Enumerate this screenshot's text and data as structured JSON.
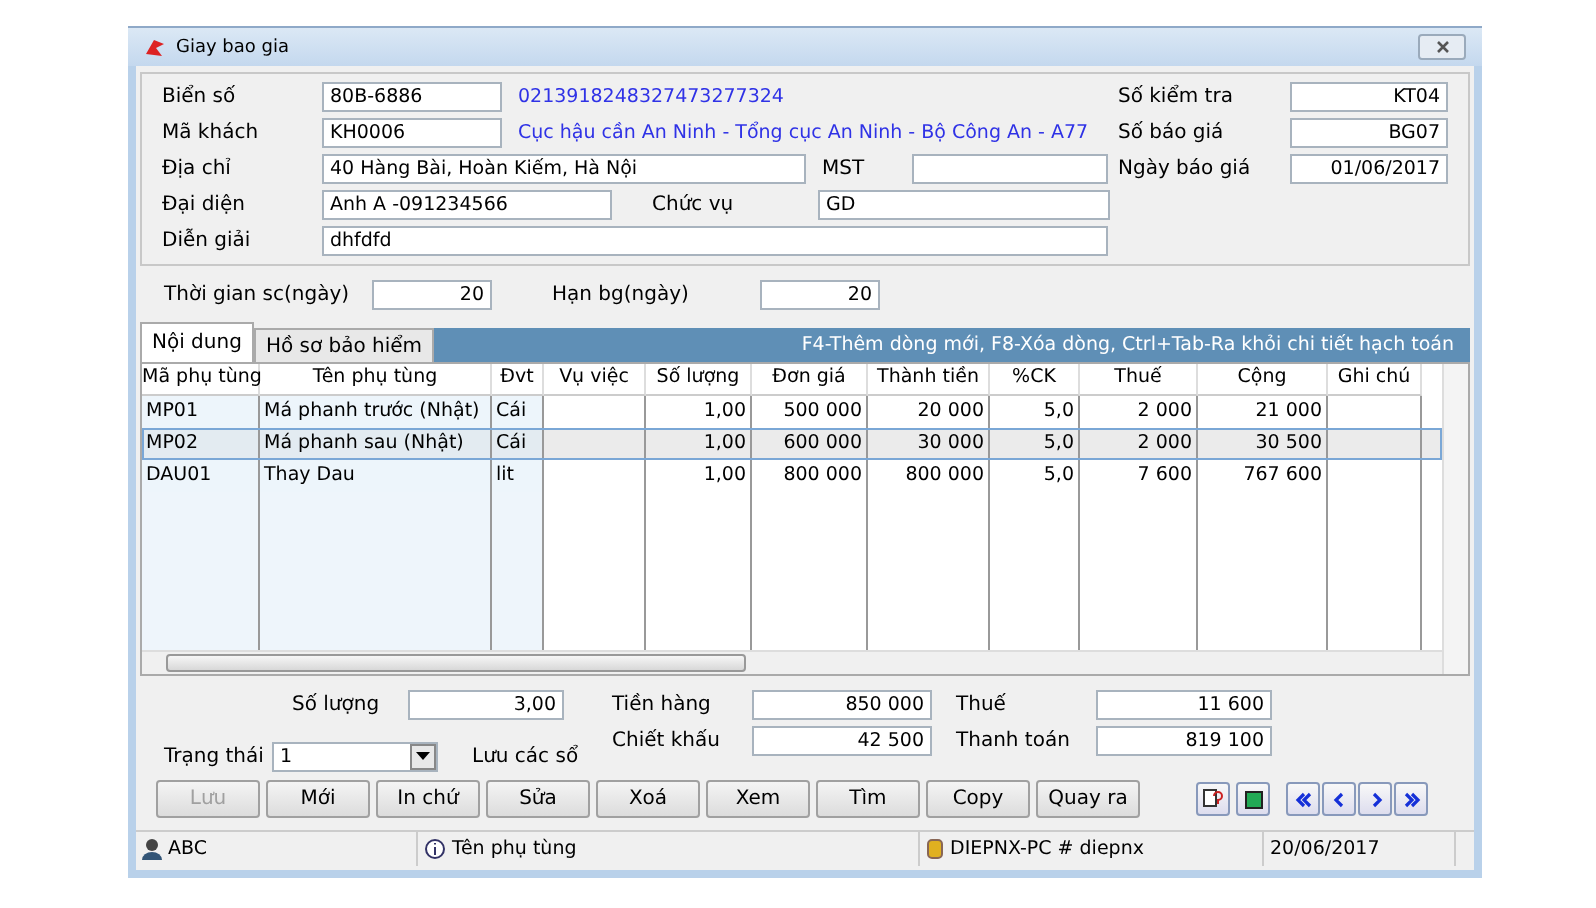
{
  "window": {
    "title": "Giay bao gia"
  },
  "header": {
    "fields": [
      {
        "label": "Biển số",
        "value": "80B-6886",
        "note": "0213918248327473277324"
      },
      {
        "label": "Mã khách",
        "value": "KH0006",
        "note": "Cục hậu cần An Ninh - Tổng cục An Ninh - Bộ Công An - A77"
      }
    ],
    "address": {
      "label": "Địa chỉ",
      "value": "40 Hàng Bài, Hoàn Kiếm, Hà Nội",
      "label2": "MST"
    },
    "rep": {
      "label": "Đại diện",
      "value": "Anh A -091234566",
      "label2": "Chức vụ",
      "value2": "GD"
    },
    "desc": {
      "label": "Diễn giải",
      "value": "dhfdfd"
    },
    "right": [
      {
        "label": "Số kiểm tra",
        "value": "KT04"
      },
      {
        "label": "Số báo giá",
        "value": "BG07"
      },
      {
        "label": "Ngày báo giá",
        "value": "01/06/2017"
      }
    ]
  },
  "times": [
    {
      "label": "Thời gian sc(ngày)",
      "value": "20"
    },
    {
      "label": "Hạn bg(ngày)",
      "value": "20"
    }
  ],
  "tabs": [
    {
      "label": "Nội dung",
      "selected": true
    },
    {
      "label": "Hồ sơ bảo hiểm",
      "selected": false
    }
  ],
  "hint": "F4-Thêm dòng mới, F8-Xóa dòng, Ctrl+Tab-Ra khỏi chi tiết hạch toán",
  "table": {
    "columns": [
      "Mã phụ tùng",
      "Tên phụ tùng",
      "Đvt",
      "Vụ việc",
      "Số lượng",
      "Đơn giá",
      "Thành tiền",
      "%CK",
      "Thuế",
      "Cộng",
      "Ghi chú"
    ],
    "rows": [
      {
        "selected": false,
        "cells": [
          "MP01",
          "Má phanh trước (Nhật)",
          "Cái",
          "",
          "1,00",
          "500 000",
          "20 000",
          "5,0",
          "2 000",
          "21 000",
          ""
        ]
      },
      {
        "selected": true,
        "cells": [
          "MP02",
          "Má phanh sau (Nhật)",
          "Cái",
          "",
          "1,00",
          "600 000",
          "30 000",
          "5,0",
          "2 000",
          "30 500",
          ""
        ]
      },
      {
        "selected": false,
        "cells": [
          "DAU01",
          "Thay Dau",
          "lit",
          "",
          "1,00",
          "800 000",
          "800 000",
          "5,0",
          "7 600",
          "767 600",
          ""
        ]
      }
    ]
  },
  "totals": [
    {
      "label": "Số lượng",
      "value": "3,00"
    },
    {
      "label": "Tiền hàng",
      "value": "850 000"
    },
    {
      "label": "Thuế",
      "value": "11 600"
    },
    {
      "label": "Chiết khấu",
      "value": "42 500"
    },
    {
      "label": "Thanh toán",
      "value": "819 100"
    }
  ],
  "status": {
    "label": "Trạng thái",
    "value": "1",
    "save_label": "Lưu các sổ"
  },
  "buttons": [
    {
      "label": "Lưu",
      "disabled": true
    },
    {
      "label": "Mới",
      "disabled": false
    },
    {
      "label": "In chứ",
      "disabled": false
    },
    {
      "label": "Sửa",
      "disabled": false
    },
    {
      "label": "Xoá",
      "disabled": false
    },
    {
      "label": "Xem",
      "disabled": false
    },
    {
      "label": "Tìm",
      "disabled": false
    },
    {
      "label": "Copy",
      "disabled": false
    },
    {
      "label": "Quay ra",
      "disabled": false
    }
  ],
  "status_bar": [
    "ABC",
    "Tên phụ tùng",
    "DIEPNX-PC # diepnx",
    "20/06/2017"
  ]
}
